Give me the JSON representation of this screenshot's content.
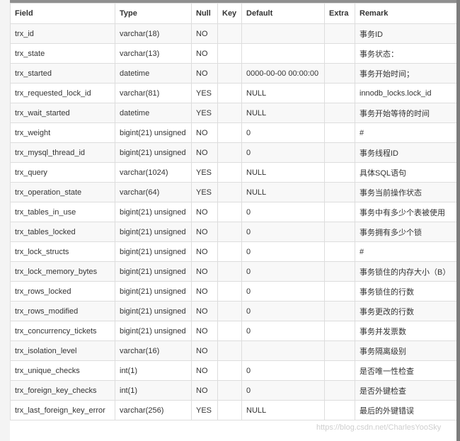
{
  "table": {
    "columns": [
      "Field",
      "Type",
      "Null",
      "Key",
      "Default",
      "Extra",
      "Remark"
    ],
    "rows": [
      {
        "field": "trx_id",
        "type": "varchar(18)",
        "null": "NO",
        "key": "",
        "default": "",
        "extra": "",
        "remark": "事务ID"
      },
      {
        "field": "trx_state",
        "type": "varchar(13)",
        "null": "NO",
        "key": "",
        "default": "",
        "extra": "",
        "remark": "事务状态："
      },
      {
        "field": "trx_started",
        "type": "datetime",
        "null": "NO",
        "key": "",
        "default": "0000-00-00 00:00:00",
        "extra": "",
        "remark": "事务开始时间；"
      },
      {
        "field": "trx_requested_lock_id",
        "type": "varchar(81)",
        "null": "YES",
        "key": "",
        "default": "NULL",
        "extra": "",
        "remark": "innodb_locks.lock_id"
      },
      {
        "field": "trx_wait_started",
        "type": "datetime",
        "null": "YES",
        "key": "",
        "default": "NULL",
        "extra": "",
        "remark": "事务开始等待的时间"
      },
      {
        "field": "trx_weight",
        "type": "bigint(21) unsigned",
        "null": "NO",
        "key": "",
        "default": "0",
        "extra": "",
        "remark": "#"
      },
      {
        "field": "trx_mysql_thread_id",
        "type": "bigint(21) unsigned",
        "null": "NO",
        "key": "",
        "default": "0",
        "extra": "",
        "remark": "事务线程ID"
      },
      {
        "field": "trx_query",
        "type": "varchar(1024)",
        "null": "YES",
        "key": "",
        "default": "NULL",
        "extra": "",
        "remark": "具体SQL语句"
      },
      {
        "field": "trx_operation_state",
        "type": "varchar(64)",
        "null": "YES",
        "key": "",
        "default": "NULL",
        "extra": "",
        "remark": "事务当前操作状态"
      },
      {
        "field": "trx_tables_in_use",
        "type": "bigint(21) unsigned",
        "null": "NO",
        "key": "",
        "default": "0",
        "extra": "",
        "remark": "事务中有多少个表被使用"
      },
      {
        "field": "trx_tables_locked",
        "type": "bigint(21) unsigned",
        "null": "NO",
        "key": "",
        "default": "0",
        "extra": "",
        "remark": "事务拥有多少个锁"
      },
      {
        "field": "trx_lock_structs",
        "type": "bigint(21) unsigned",
        "null": "NO",
        "key": "",
        "default": "0",
        "extra": "",
        "remark": "#"
      },
      {
        "field": "trx_lock_memory_bytes",
        "type": "bigint(21) unsigned",
        "null": "NO",
        "key": "",
        "default": "0",
        "extra": "",
        "remark": "事务锁住的内存大小（B）"
      },
      {
        "field": "trx_rows_locked",
        "type": "bigint(21) unsigned",
        "null": "NO",
        "key": "",
        "default": "0",
        "extra": "",
        "remark": "事务锁住的行数"
      },
      {
        "field": "trx_rows_modified",
        "type": "bigint(21) unsigned",
        "null": "NO",
        "key": "",
        "default": "0",
        "extra": "",
        "remark": "事务更改的行数"
      },
      {
        "field": "trx_concurrency_tickets",
        "type": "bigint(21) unsigned",
        "null": "NO",
        "key": "",
        "default": "0",
        "extra": "",
        "remark": "事务并发票数"
      },
      {
        "field": "trx_isolation_level",
        "type": "varchar(16)",
        "null": "NO",
        "key": "",
        "default": "",
        "extra": "",
        "remark": "事务隔离级别"
      },
      {
        "field": "trx_unique_checks",
        "type": "int(1)",
        "null": "NO",
        "key": "",
        "default": "0",
        "extra": "",
        "remark": "是否唯一性检查"
      },
      {
        "field": "trx_foreign_key_checks",
        "type": "int(1)",
        "null": "NO",
        "key": "",
        "default": "0",
        "extra": "",
        "remark": "是否外键检查"
      },
      {
        "field": "trx_last_foreign_key_error",
        "type": "varchar(256)",
        "null": "YES",
        "key": "",
        "default": "NULL",
        "extra": "",
        "remark": "最后的外键错误"
      }
    ]
  },
  "watermark": "https://blog.csdn.net/CharlesYooSky"
}
